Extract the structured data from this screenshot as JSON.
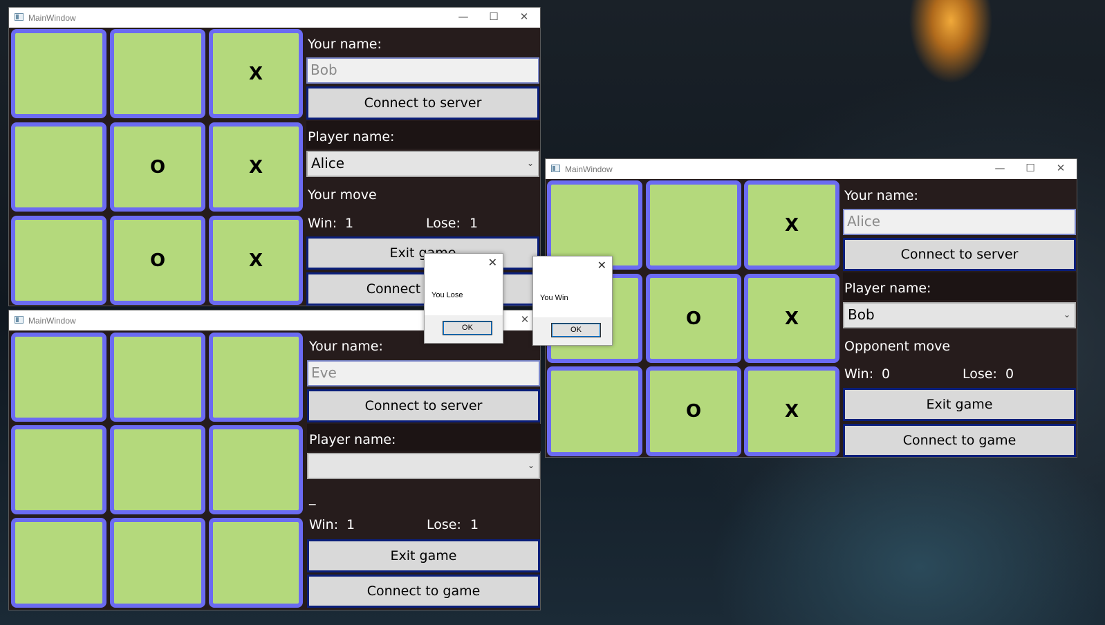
{
  "windows": {
    "bob": {
      "title": "MainWindow",
      "controls": {
        "minimize": "—",
        "maximize": "☐",
        "close": "✕"
      },
      "board": [
        "",
        "",
        "X",
        "",
        "O",
        "X",
        "",
        "O",
        "X"
      ],
      "your_name_label": "Your name:",
      "your_name_value": "Bob",
      "connect_server": "Connect to server",
      "player_name_label": "Player name:",
      "player_name_selected": "Alice",
      "status": "Your move",
      "win_label": "Win:",
      "win_value": "1",
      "lose_label": "Lose:",
      "lose_value": "1",
      "exit_game": "Exit game",
      "connect_game": "Connect to game"
    },
    "eve": {
      "title": "MainWindow",
      "controls": {
        "close": "✕"
      },
      "board": [
        "",
        "",
        "",
        "",
        "",
        "",
        "",
        "",
        ""
      ],
      "your_name_label": "Your name:",
      "your_name_value": "Eve",
      "connect_server": "Connect to server",
      "player_name_label": "Player name:",
      "player_name_selected": "",
      "status": "_",
      "win_label": "Win:",
      "win_value": "1",
      "lose_label": "Lose:",
      "lose_value": "1",
      "exit_game": "Exit game",
      "connect_game": "Connect to game"
    },
    "alice": {
      "title": "MainWindow",
      "controls": {
        "minimize": "—",
        "maximize": "☐",
        "close": "✕"
      },
      "board": [
        "",
        "",
        "X",
        "",
        "O",
        "X",
        "",
        "O",
        "X"
      ],
      "your_name_label": "Your name:",
      "your_name_value": "Alice",
      "connect_server": "Connect to server",
      "player_name_label": "Player name:",
      "player_name_selected": "Bob",
      "status": "Opponent move",
      "win_label": "Win:",
      "win_value": "0",
      "lose_label": "Lose:",
      "lose_value": "0",
      "exit_game": "Exit game",
      "connect_game": "Connect to game"
    }
  },
  "dialogs": {
    "lose": {
      "message": "You Lose",
      "ok": "OK",
      "close": "✕"
    },
    "win": {
      "message": "You Win",
      "ok": "OK",
      "close": "✕"
    }
  },
  "icons": {
    "combo_chevron": "chevron-down-icon",
    "app_icon": "window-icon"
  },
  "colors": {
    "cell_fill": "#b4d97c",
    "cell_border": "#6b6bf2",
    "panel_bg": "#261c1c",
    "button_border": "#0a1e7a"
  }
}
